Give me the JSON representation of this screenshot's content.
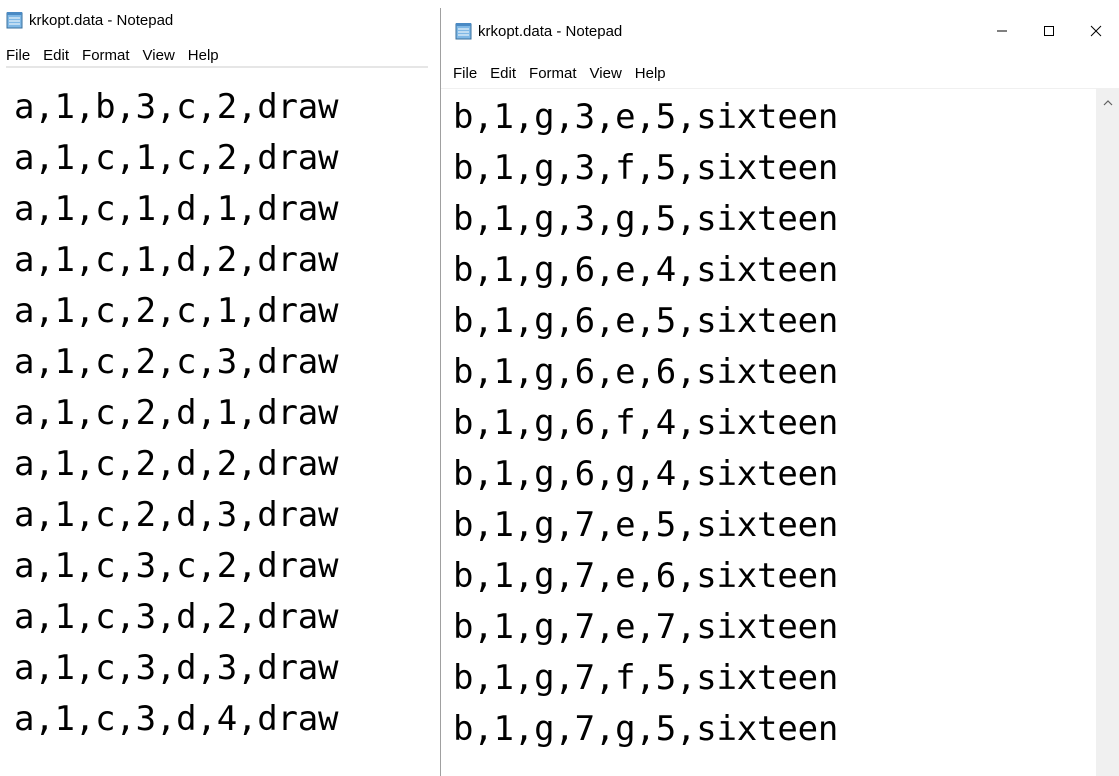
{
  "left_window": {
    "title": "krkopt.data - Notepad",
    "icon": "notepad-icon",
    "menu": [
      "File",
      "Edit",
      "Format",
      "View",
      "Help"
    ],
    "lines": [
      "a,1,b,3,c,2,draw",
      "a,1,c,1,c,2,draw",
      "a,1,c,1,d,1,draw",
      "a,1,c,1,d,2,draw",
      "a,1,c,2,c,1,draw",
      "a,1,c,2,c,3,draw",
      "a,1,c,2,d,1,draw",
      "a,1,c,2,d,2,draw",
      "a,1,c,2,d,3,draw",
      "a,1,c,3,c,2,draw",
      "a,1,c,3,d,2,draw",
      "a,1,c,3,d,3,draw",
      "a,1,c,3,d,4,draw"
    ]
  },
  "right_window": {
    "title": "krkopt.data - Notepad",
    "icon": "notepad-icon",
    "menu": [
      "File",
      "Edit",
      "Format",
      "View",
      "Help"
    ],
    "controls": [
      "minimize-icon",
      "maximize-icon",
      "close-icon"
    ],
    "lines": [
      "b,1,g,3,e,5,sixteen",
      "b,1,g,3,f,5,sixteen",
      "b,1,g,3,g,5,sixteen",
      "b,1,g,6,e,4,sixteen",
      "b,1,g,6,e,5,sixteen",
      "b,1,g,6,e,6,sixteen",
      "b,1,g,6,f,4,sixteen",
      "b,1,g,6,g,4,sixteen",
      "b,1,g,7,e,5,sixteen",
      "b,1,g,7,e,6,sixteen",
      "b,1,g,7,e,7,sixteen",
      "b,1,g,7,f,5,sixteen",
      "b,1,g,7,g,5,sixteen"
    ]
  }
}
